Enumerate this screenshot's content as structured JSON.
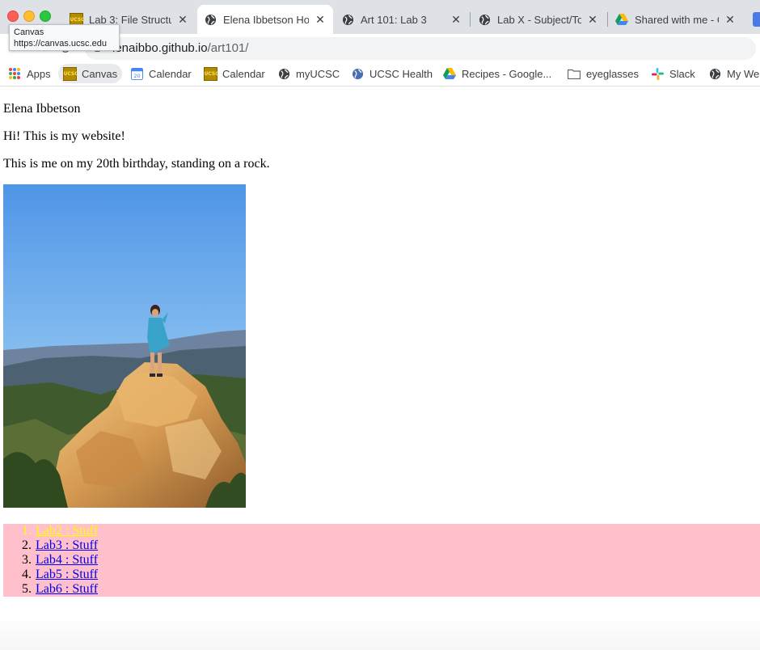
{
  "tabs": [
    {
      "label": "Lab 3: File Structu",
      "favicon": "ucsc-icon",
      "active": false
    },
    {
      "label": "Elena Ibbetson Ho",
      "favicon": "globe-icon",
      "active": true
    },
    {
      "label": "Art 101: Lab 3",
      "favicon": "globe-icon",
      "active": false
    },
    {
      "label": "Lab X - Subject/To",
      "favicon": "globe-icon",
      "active": false
    },
    {
      "label": "Shared with me - G",
      "favicon": "google-drive-icon",
      "active": false
    }
  ],
  "tooltip": {
    "title": "Canvas",
    "url": "https://canvas.ucsc.edu"
  },
  "address": {
    "host": "elenaibbo.github.io",
    "path": "/art101/",
    "visible_host": "lenaibbo.github.io"
  },
  "bookmarks": [
    {
      "label": "Apps",
      "icon": "apps-grid-icon"
    },
    {
      "label": "Canvas",
      "icon": "ucsc-icon"
    },
    {
      "label": "Calendar",
      "icon": "google-calendar-icon"
    },
    {
      "label": "Calendar",
      "icon": "ucsc-icon"
    },
    {
      "label": "myUCSC",
      "icon": "globe-icon"
    },
    {
      "label": "UCSC Health",
      "icon": "globe-icon"
    },
    {
      "label": "Recipes - Google...",
      "icon": "google-drive-icon"
    },
    {
      "label": "eyeglasses",
      "icon": "folder-icon"
    },
    {
      "label": "Slack",
      "icon": "slack-icon"
    },
    {
      "label": "My Wel",
      "icon": "globe-icon"
    }
  ],
  "page": {
    "name": "Elena Ibbetson",
    "greeting": "Hi! This is my website!",
    "caption": "This is me on my 20th birthday, standing on a rock.",
    "labs": [
      {
        "label": "Lab2 : Stuff"
      },
      {
        "label": "Lab3 : Stuff"
      },
      {
        "label": "Lab4 : Stuff"
      },
      {
        "label": "Lab5 : Stuff"
      },
      {
        "label": "Lab6 : Stuff"
      }
    ]
  },
  "colors": {
    "list_background": "#ffc0cb",
    "link": "#0000ee",
    "link_hover": "#ffff00"
  }
}
